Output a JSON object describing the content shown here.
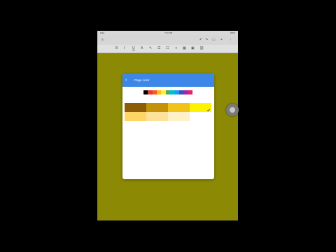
{
  "statusbar": {
    "left": "iPad",
    "time": "7:31 PM",
    "right": "100%"
  },
  "toolbar": {
    "top_icons": [
      "menu-icon",
      "undo-icon",
      "redo-icon",
      "comment-icon",
      "add-icon",
      "more-icon"
    ],
    "format_icons": [
      "bold-icon",
      "italic-icon",
      "underline-icon",
      "text-color-icon",
      "pen-icon",
      "align-icon",
      "list-icon",
      "indent-icon",
      "table-icon",
      "image-icon",
      "link-icon"
    ]
  },
  "dialog": {
    "title": "Page color",
    "back_icon": "back-arrow-icon",
    "hues": [
      "#000000",
      "#e53935",
      "#ff5722",
      "#ffc107",
      "#ffeb3b",
      "#4caf50",
      "#00bcd4",
      "#2196f3",
      "#3f51b5",
      "#9c27b0",
      "#e91e63"
    ],
    "shade_rows": [
      [
        "#8a5d06",
        "#c4910b",
        "#f0c21a",
        "#fff200"
      ],
      [
        "#ffd566",
        "#ffe29a",
        "#fff0c8",
        "#ffffff"
      ]
    ],
    "selected": "#fff200"
  },
  "colors": {
    "page": "#8c8a05",
    "accent": "#3c87e8"
  }
}
